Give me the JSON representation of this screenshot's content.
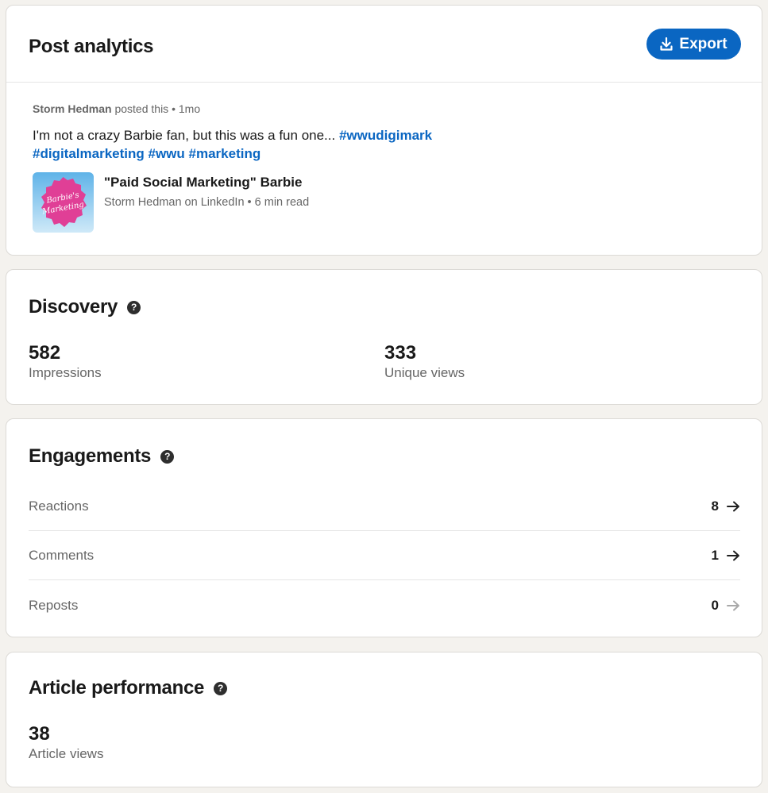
{
  "header": {
    "title": "Post analytics",
    "export_label": "Export"
  },
  "post": {
    "author": "Storm Hedman",
    "action": "posted this",
    "separator": "•",
    "time": "1mo",
    "text": "I'm not a crazy Barbie fan, but this was a fun one...",
    "hashtags": [
      "#wwudigimark",
      "#digitalmarketing",
      "#wwu",
      "#marketing"
    ],
    "thumbnail_text": [
      "Barbie's",
      "Marketing"
    ],
    "article_title": "\"Paid Social Marketing\" Barbie",
    "article_source": "Storm Hedman on LinkedIn",
    "article_read_time": "6 min read"
  },
  "discovery": {
    "title": "Discovery",
    "help_icon": "question-circle-icon",
    "metrics": [
      {
        "value": "582",
        "label": "Impressions"
      },
      {
        "value": "333",
        "label": "Unique views"
      }
    ]
  },
  "engagements": {
    "title": "Engagements",
    "help_icon": "question-circle-icon",
    "rows": [
      {
        "label": "Reactions",
        "count": "8",
        "arrow_color": "#1f1f1f"
      },
      {
        "label": "Comments",
        "count": "1",
        "arrow_color": "#1f1f1f"
      },
      {
        "label": "Reposts",
        "count": "0",
        "arrow_color": "#a8a8a8"
      }
    ]
  },
  "article_performance": {
    "title": "Article performance",
    "help_icon": "question-circle-icon",
    "metric": {
      "value": "38",
      "label": "Article views"
    }
  },
  "colors": {
    "accent": "#0a66c2",
    "background": "#f4f2ee",
    "muted_text": "#666666"
  }
}
